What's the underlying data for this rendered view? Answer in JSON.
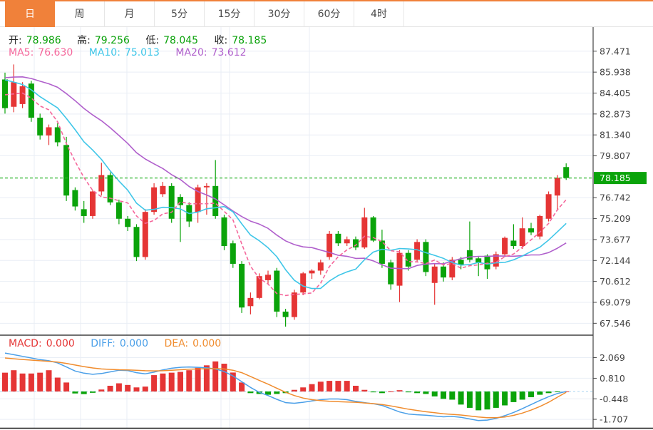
{
  "tabs": {
    "items": [
      {
        "label": "日",
        "selected": true
      },
      {
        "label": "周",
        "selected": false
      },
      {
        "label": "月",
        "selected": false
      },
      {
        "label": "5分",
        "selected": false
      },
      {
        "label": "15分",
        "selected": false
      },
      {
        "label": "30分",
        "selected": false
      },
      {
        "label": "60分",
        "selected": false
      },
      {
        "label": "4时",
        "selected": false
      }
    ]
  },
  "ohlc": {
    "open_label": "开:",
    "open": "78.986",
    "high_label": "高:",
    "high": "79.256",
    "low_label": "低:",
    "low": "78.045",
    "close_label": "收:",
    "close": "78.185"
  },
  "ma": {
    "ma5_label": "MA5:",
    "ma5": "76.630",
    "ma10_label": "MA10:",
    "ma10": "75.013",
    "ma20_label": "MA20:",
    "ma20": "73.612"
  },
  "macd_header": {
    "macd_label": "MACD:",
    "macd": "0.000",
    "diff_label": "DIFF:",
    "diff": "0.000",
    "dea_label": "DEA:",
    "dea": "0.000"
  },
  "colors": {
    "accent_orange": "#f0813a",
    "up_red": "#e53535",
    "down_green": "#0aa30a",
    "ma5_pink": "#f5679b",
    "ma10_cyan": "#3fc6e8",
    "ma20_purple": "#b060cc",
    "diff_blue": "#4a9fe8",
    "dea_orange": "#f08c2e",
    "grid": "#e9eef5",
    "vgrid": "#e8eef4",
    "axis_line": "#444444",
    "axis_text": "#444444",
    "separator": "#1a1a1a",
    "tag_green": "#0aa30a",
    "price_line_green": "#2ab52a",
    "zero_line_blue": "#a8d5f2"
  },
  "chart_data": {
    "type": "candlestick+macd",
    "title": "",
    "legend": [
      "MA5",
      "MA10",
      "MA20",
      "MACD",
      "DIFF",
      "DEA"
    ],
    "price_axis_ticks": [
      "87.471",
      "85.938",
      "84.405",
      "82.873",
      "81.340",
      "79.807",
      "76.742",
      "75.209",
      "73.677",
      "72.144",
      "70.612",
      "69.079",
      "67.546"
    ],
    "macd_axis_ticks": [
      "2.069",
      "0.810",
      "-0.448",
      "-1.707"
    ],
    "current_price": 78.185,
    "current_price_label": "78.185",
    "price_range_est": [
      66.78,
      88.87
    ],
    "macd_range_est": [
      -2.26,
      3.45
    ],
    "ma_periods": [
      5,
      10,
      20
    ],
    "vertical_gridlines_x": [
      48,
      113,
      178,
      310,
      322,
      434
    ],
    "grid_on": true,
    "legend_position": "top-left",
    "candles": [
      [
        85.4,
        85.9,
        82.9,
        83.3
      ],
      [
        83.4,
        86.5,
        83.0,
        85.2
      ],
      [
        83.6,
        85.2,
        83.3,
        84.9
      ],
      [
        85.1,
        85.3,
        82.3,
        82.6
      ],
      [
        82.6,
        82.9,
        81.0,
        81.3
      ],
      [
        81.3,
        82.1,
        80.6,
        81.9
      ],
      [
        81.9,
        82.2,
        80.5,
        80.8
      ],
      [
        80.6,
        81.2,
        76.5,
        76.9
      ],
      [
        77.3,
        77.5,
        75.8,
        76.1
      ],
      [
        75.9,
        76.5,
        74.9,
        75.4
      ],
      [
        75.4,
        77.3,
        75.2,
        77.2
      ],
      [
        77.2,
        79.3,
        76.9,
        78.4
      ],
      [
        78.4,
        78.6,
        76.2,
        76.4
      ],
      [
        76.4,
        76.6,
        74.8,
        75.2
      ],
      [
        75.2,
        75.4,
        74.3,
        74.6
      ],
      [
        74.6,
        74.8,
        72.1,
        72.4
      ],
      [
        72.4,
        75.9,
        72.2,
        75.7
      ],
      [
        75.7,
        77.8,
        75.5,
        77.5
      ],
      [
        77.0,
        77.9,
        76.8,
        77.6
      ],
      [
        77.6,
        77.8,
        74.9,
        75.2
      ],
      [
        76.8,
        77.0,
        73.5,
        76.2
      ],
      [
        76.2,
        76.4,
        74.6,
        75.0
      ],
      [
        75.7,
        77.7,
        74.9,
        77.5
      ],
      [
        77.5,
        77.8,
        75.5,
        77.6
      ],
      [
        77.6,
        79.5,
        75.2,
        75.4
      ],
      [
        75.3,
        75.5,
        72.9,
        73.2
      ],
      [
        73.4,
        73.6,
        71.6,
        71.9
      ],
      [
        71.9,
        72.1,
        68.3,
        68.7
      ],
      [
        68.8,
        69.8,
        68.2,
        69.4
      ],
      [
        69.4,
        71.2,
        69.3,
        71.0
      ],
      [
        70.7,
        71.4,
        70.4,
        71.1
      ],
      [
        71.4,
        71.6,
        68.0,
        68.4
      ],
      [
        68.4,
        68.6,
        67.3,
        68.0
      ],
      [
        68.0,
        70.0,
        67.8,
        69.8
      ],
      [
        69.8,
        71.3,
        69.6,
        71.2
      ],
      [
        71.2,
        71.5,
        70.8,
        71.4
      ],
      [
        71.4,
        72.2,
        71.1,
        72.0
      ],
      [
        72.4,
        74.3,
        72.2,
        74.1
      ],
      [
        74.1,
        74.3,
        73.2,
        73.4
      ],
      [
        73.4,
        73.9,
        73.2,
        73.7
      ],
      [
        73.7,
        73.9,
        72.9,
        73.1
      ],
      [
        73.1,
        76.0,
        73.0,
        75.3
      ],
      [
        75.3,
        75.4,
        73.5,
        73.6
      ],
      [
        73.6,
        74.4,
        71.6,
        71.9
      ],
      [
        72.0,
        72.2,
        70.0,
        70.4
      ],
      [
        70.3,
        72.9,
        69.1,
        72.7
      ],
      [
        72.7,
        72.9,
        71.4,
        71.7
      ],
      [
        72.2,
        73.7,
        72.0,
        73.5
      ],
      [
        73.5,
        73.7,
        71.0,
        71.3
      ],
      [
        70.5,
        71.9,
        68.9,
        71.7
      ],
      [
        71.7,
        72.0,
        70.6,
        70.9
      ],
      [
        70.9,
        72.4,
        70.7,
        72.2
      ],
      [
        72.2,
        72.4,
        71.5,
        71.8
      ],
      [
        72.9,
        75.0,
        72.0,
        72.2
      ],
      [
        72.3,
        72.4,
        71.0,
        72.0
      ],
      [
        72.5,
        72.6,
        70.8,
        71.5
      ],
      [
        71.7,
        72.8,
        71.5,
        72.6
      ],
      [
        72.6,
        73.9,
        72.4,
        73.8
      ],
      [
        73.6,
        74.8,
        73.0,
        73.2
      ],
      [
        73.2,
        75.3,
        73.0,
        74.5
      ],
      [
        74.5,
        74.9,
        74.0,
        74.2
      ],
      [
        73.9,
        75.5,
        73.7,
        75.4
      ],
      [
        75.2,
        77.2,
        75.0,
        77.0
      ],
      [
        76.9,
        78.4,
        75.8,
        78.2
      ],
      [
        78.986,
        79.256,
        78.045,
        78.185
      ]
    ],
    "pre_history_closes": [
      84.0,
      84.3,
      84.6,
      85.0,
      85.3,
      85.6,
      85.9,
      86.2,
      86.5,
      86.7,
      86.8,
      86.8,
      86.7,
      86.5,
      86.3,
      86.0,
      84.9,
      84.6,
      84.4,
      84.2
    ],
    "macd": {
      "bars": [
        1.15,
        1.3,
        1.1,
        1.1,
        1.15,
        1.3,
        0.85,
        0.55,
        -0.12,
        -0.16,
        -0.08,
        0.12,
        0.35,
        0.5,
        0.4,
        0.25,
        0.3,
        1.0,
        1.1,
        1.15,
        1.2,
        1.3,
        1.45,
        1.6,
        1.84,
        1.7,
        1.16,
        0.55,
        -0.1,
        -0.15,
        -0.2,
        -0.15,
        -0.1,
        0.1,
        0.25,
        0.45,
        0.6,
        0.65,
        0.65,
        0.65,
        0.35,
        0.1,
        -0.05,
        -0.1,
        0.0,
        0.08,
        -0.05,
        -0.1,
        -0.15,
        -0.3,
        -0.45,
        -0.5,
        -0.8,
        -1.0,
        -1.15,
        -1.1,
        -1.0,
        -0.85,
        -0.65,
        -0.5,
        -0.35,
        -0.2,
        -0.1,
        -0.03,
        0.0
      ],
      "diff": [
        2.35,
        2.25,
        2.15,
        2.05,
        1.95,
        1.88,
        1.75,
        1.5,
        1.25,
        1.12,
        1.05,
        1.1,
        1.2,
        1.3,
        1.28,
        1.15,
        1.08,
        1.18,
        1.32,
        1.42,
        1.48,
        1.5,
        1.48,
        1.45,
        1.38,
        1.22,
        0.95,
        0.6,
        0.25,
        -0.05,
        -0.25,
        -0.48,
        -0.68,
        -0.72,
        -0.66,
        -0.58,
        -0.5,
        -0.46,
        -0.46,
        -0.5,
        -0.6,
        -0.68,
        -0.75,
        -0.85,
        -1.05,
        -1.25,
        -1.38,
        -1.42,
        -1.45,
        -1.5,
        -1.55,
        -1.52,
        -1.58,
        -1.68,
        -1.78,
        -1.75,
        -1.65,
        -1.48,
        -1.28,
        -1.05,
        -0.8,
        -0.55,
        -0.32,
        -0.12,
        0.0
      ],
      "dea": [
        2.05,
        2.0,
        1.96,
        1.92,
        1.88,
        1.84,
        1.8,
        1.72,
        1.62,
        1.52,
        1.44,
        1.38,
        1.35,
        1.33,
        1.32,
        1.3,
        1.27,
        1.26,
        1.27,
        1.3,
        1.33,
        1.36,
        1.38,
        1.39,
        1.4,
        1.38,
        1.3,
        1.15,
        0.92,
        0.68,
        0.45,
        0.2,
        -0.05,
        -0.25,
        -0.4,
        -0.5,
        -0.56,
        -0.6,
        -0.62,
        -0.64,
        -0.66,
        -0.7,
        -0.74,
        -0.8,
        -0.88,
        -0.98,
        -1.08,
        -1.16,
        -1.24,
        -1.3,
        -1.36,
        -1.4,
        -1.44,
        -1.5,
        -1.56,
        -1.6,
        -1.6,
        -1.56,
        -1.46,
        -1.32,
        -1.14,
        -0.92,
        -0.66,
        -0.35,
        -0.05
      ]
    }
  }
}
